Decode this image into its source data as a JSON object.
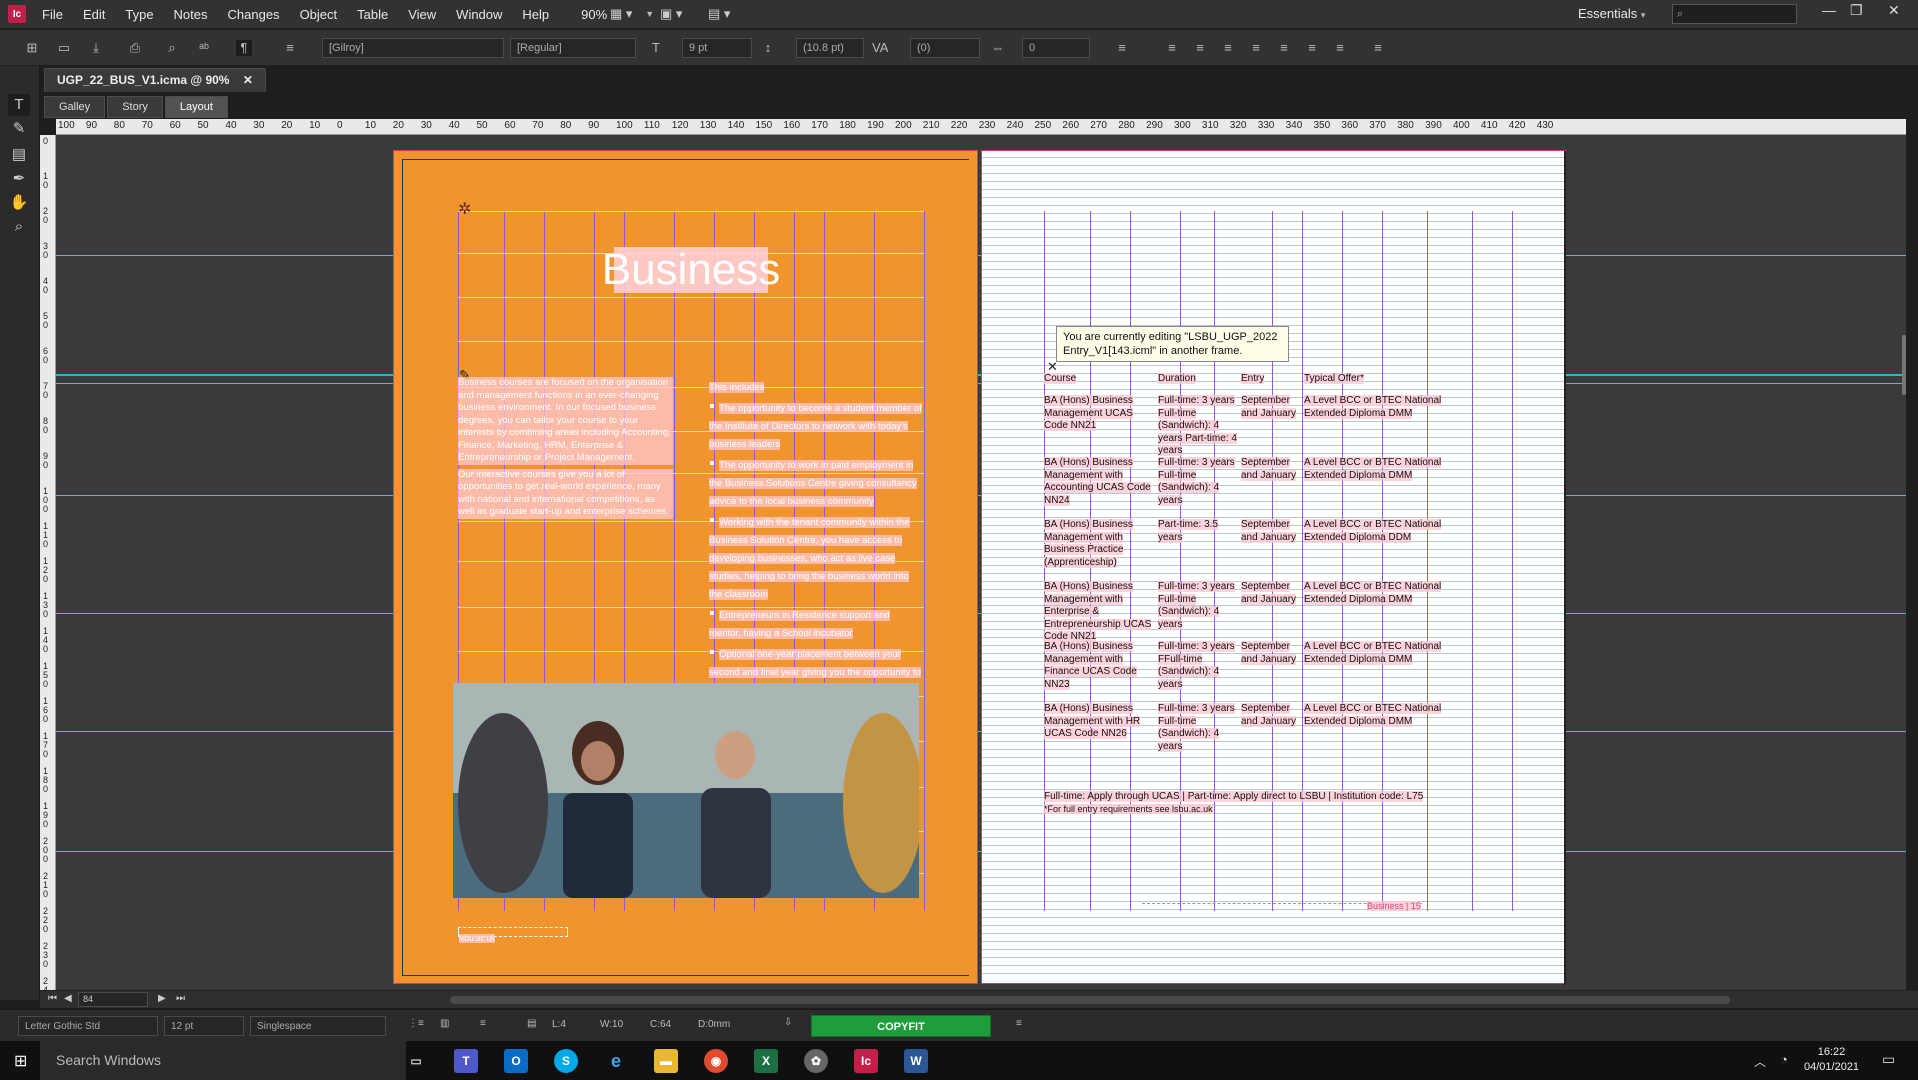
{
  "app": {
    "logo": "Ic",
    "menu": [
      "File",
      "Edit",
      "Type",
      "Notes",
      "Changes",
      "Object",
      "Table",
      "View",
      "Window",
      "Help"
    ],
    "zoom": "90%",
    "workspace": "Essentials"
  },
  "controlbar": {
    "font_family": "[Gilroy]",
    "font_style": "[Regular]",
    "font_size": "9 pt",
    "leading": "(10.8 pt)",
    "kerning": "(0)",
    "tracking": "0"
  },
  "document": {
    "tab_title": "UGP_22_BUS_V1.icma @ 90%",
    "view_tabs": [
      "Galley",
      "Story",
      "Layout"
    ],
    "active_view": "Layout"
  },
  "ruler": {
    "h_labels": [
      "100",
      "90",
      "80",
      "70",
      "60",
      "50",
      "40",
      "30",
      "20",
      "10",
      "0",
      "10",
      "20",
      "30",
      "40",
      "50",
      "60",
      "70",
      "80",
      "90",
      "100",
      "110",
      "120",
      "130",
      "140",
      "150",
      "160",
      "170",
      "180",
      "190",
      "200",
      "210",
      "220",
      "230",
      "240",
      "250",
      "260",
      "270",
      "280",
      "290",
      "300",
      "310",
      "320",
      "330",
      "340",
      "350",
      "360",
      "370",
      "380",
      "390",
      "400",
      "410",
      "420",
      "430"
    ],
    "v_labels": [
      "0",
      "10",
      "20",
      "30",
      "40",
      "50",
      "60",
      "70",
      "80",
      "90",
      "100",
      "110",
      "120",
      "130",
      "140",
      "150",
      "160",
      "170",
      "180",
      "190",
      "200",
      "210",
      "220",
      "230",
      "240"
    ]
  },
  "left_page": {
    "heading": "Business",
    "col1_text": "Business courses are focused on the organisation and management functions in an ever-changing business environment. In our focused business degrees, you can tailor your course to your interests by combining areas including Accounting, Finance, Marketing, HRM, Enterprise & Entrepreneurship or Project Management.",
    "col1_text2": "Our interactive courses give you a lot of opportunities to get real-world experience, many with national and international competitions, as well as graduate start-up and enterprise schemes.",
    "col2_heading": "This includes",
    "col2_bullets": [
      "The opportunity to become a student member of the Institute of Directors to network with today's business leaders",
      "The opportunity to work in paid employment in the Business Solutions Centre giving consultancy advice to the local business community",
      "Working with the tenant community within the Business Solution Centre, you have access to developing businesses, who act as live case studies, helping to bring the business world into the classroom",
      "Entrepreneurs in Residence support and mentor, having a School incubator",
      "Optional one-year placement between your second and final year giving you the opportunity to enhance your real world experience"
    ],
    "footer_tag": "lsbu.ac.uk"
  },
  "right_page": {
    "table_headers": [
      "Course",
      "Duration",
      "Entry",
      "Typical Offer*"
    ],
    "rows": [
      {
        "course": "BA (Hons) Business Management UCAS Code NN21",
        "duration": "Full-time: 3 years Full-time (Sandwich): 4 years Part-time: 4 years",
        "entry": "September and January",
        "offer": "A Level BCC or BTEC National Extended Diploma DMM"
      },
      {
        "course": "BA (Hons) Business Management with Accounting UCAS Code NN24",
        "duration": "Full-time: 3 years Full-time (Sandwich): 4 years",
        "entry": "September and January",
        "offer": "A Level BCC or BTEC National Extended Diploma DMM"
      },
      {
        "course": "BA (Hons) Business Management with Business Practice (Apprenticeship)",
        "duration": "Part-time: 3.5 years",
        "entry": "September and January",
        "offer": "A Level BCC or BTEC National Extended Diploma DDM"
      },
      {
        "course": "BA (Hons) Business Management with Enterprise & Entrepreneurship UCAS Code NN21",
        "duration": "Full-time: 3 years Full-time (Sandwich): 4 years",
        "entry": "September and January",
        "offer": "A Level BCC or BTEC National Extended Diploma DMM"
      },
      {
        "course": "BA (Hons) Business Management with Finance UCAS Code NN23",
        "duration": "Full-time: 3 years FFull-time (Sandwich): 4 years",
        "entry": "September and January",
        "offer": "A Level BCC or BTEC National Extended Diploma DMM"
      },
      {
        "course": "BA (Hons) Business Management with HR UCAS Code NN26",
        "duration": "Full-time: 3 years Full-time (Sandwich): 4 years",
        "entry": "September and January",
        "offer": "A Level BCC or BTEC National Extended Diploma DMM"
      }
    ],
    "footnote1": "Full-time: Apply through UCAS | Part-time: Apply direct to LSBU | Institution code: L75",
    "footnote2": "*For full entry requirements see lsbu.ac.uk",
    "footer_tag": "Business | 15",
    "tooltip": "You are currently editing \"LSBU_UGP_2022 Entry_V1[143.icml\" in another frame."
  },
  "status": {
    "page_field": "84",
    "font": "Letter Gothic Std",
    "size": "12 pt",
    "spacing": "Singlespace",
    "line": "L:4",
    "words": "W:10",
    "chars": "C:64",
    "depth": "D:0mm",
    "copyfit": "COPYFIT"
  },
  "taskbar": {
    "search": "Search Windows",
    "time": "16:22",
    "date": "04/01/2021"
  },
  "colors": {
    "page_orange": "#f0952e",
    "copyfit_green": "#1e9e3a",
    "guide_cyan": "#34c6d6",
    "column_purple": "#8a5bd6"
  }
}
